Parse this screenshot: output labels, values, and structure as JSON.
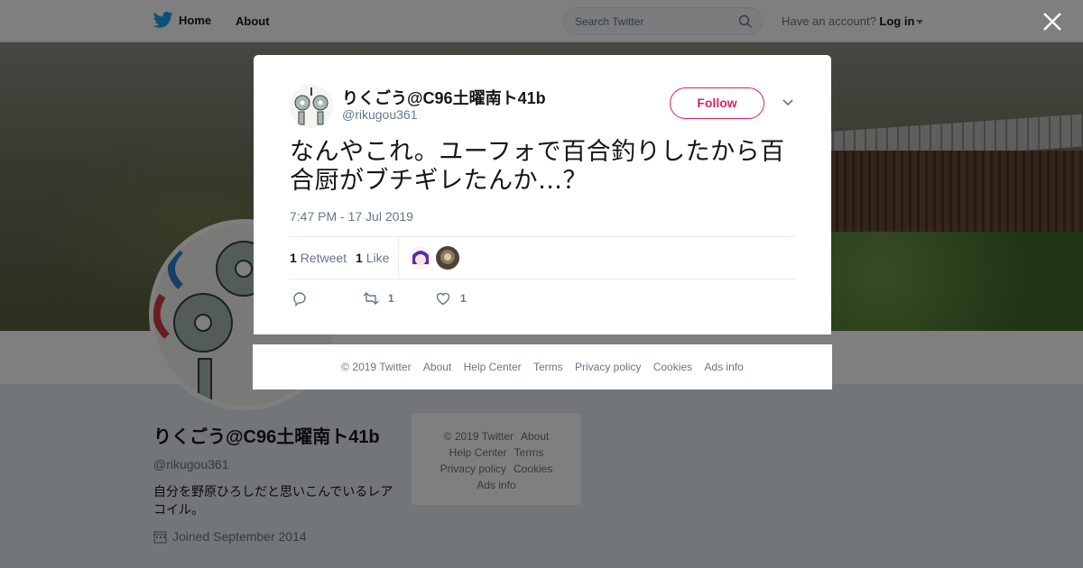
{
  "topbar": {
    "home_label": "Home",
    "about_label": "About",
    "search_placeholder": "Search Twitter",
    "account_prompt": "Have an account?",
    "login_label": "Log in"
  },
  "profile": {
    "name": "りくごう@C96土曜南ト41b",
    "handle": "@rikugou361",
    "bio": "自分を野原ひろしだと思いこんでいるレアコイル。",
    "joined": "Joined September 2014"
  },
  "side_footer": {
    "row1": [
      "© 2019 Twitter",
      "About"
    ],
    "row2": [
      "Help Center",
      "Terms"
    ],
    "row3": [
      "Privacy policy",
      "Cookies"
    ],
    "row4": [
      "Ads info"
    ]
  },
  "tweet": {
    "author_name": "りくごう@C96土曜南ト41b",
    "author_handle": "@rikugou361",
    "follow_label": "Follow",
    "text": "なんやこれ。ユーフォで百合釣りしたから百合厨がブチギレたんか…？",
    "timestamp": "7:47 PM - 17 Jul 2019",
    "retweet_count": "1",
    "retweet_label": "Retweet",
    "like_count": "1",
    "like_label": "Like",
    "action_retweet_count": "1",
    "action_like_count": "1"
  },
  "modal_footer": {
    "copyright": "© 2019 Twitter",
    "about": "About",
    "help": "Help Center",
    "terms": "Terms",
    "privacy": "Privacy policy",
    "cookies": "Cookies",
    "ads": "Ads info"
  },
  "colors": {
    "twitter_blue": "#1da1f2",
    "follow_red": "#e0245e",
    "muted_text": "#657786"
  },
  "icons": [
    "twitter-bird-icon",
    "search-icon",
    "caret-down-icon",
    "close-icon",
    "chevron-down-icon",
    "reply-icon",
    "retweet-icon",
    "heart-icon",
    "calendar-icon"
  ]
}
